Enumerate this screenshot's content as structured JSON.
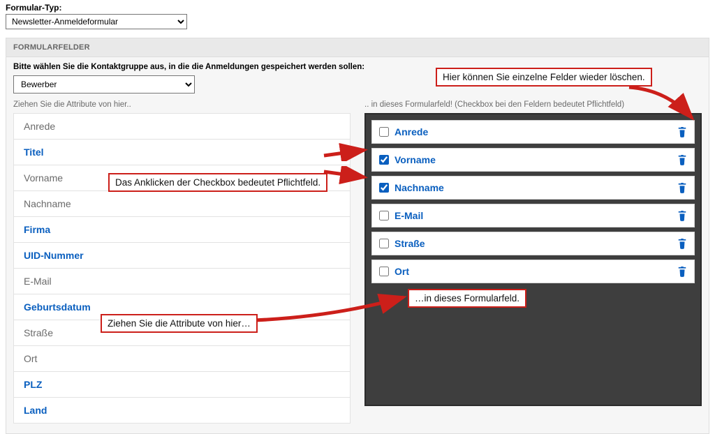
{
  "top": {
    "label": "Formular-Typ:",
    "typeSelected": "Newsletter-Anmeldeformular"
  },
  "panel": {
    "header": "FORMULARFELDER",
    "contactGroupLabel": "Bitte wählen Sie die Kontaktgruppe aus, in die die Anmeldungen gespeichert werden sollen:",
    "contactGroupSelected": "Bewerber",
    "leftHint": "Ziehen Sie die Attribute von hier..",
    "rightHint": ".. in dieses Formularfeld! (Checkbox bei den Feldern bedeutet Pflichtfeld)"
  },
  "attributes": [
    {
      "label": "Anrede",
      "style": "normal"
    },
    {
      "label": "Titel",
      "style": "blue"
    },
    {
      "label": "Vorname",
      "style": "normal"
    },
    {
      "label": "Nachname",
      "style": "normal"
    },
    {
      "label": "Firma",
      "style": "blue"
    },
    {
      "label": "UID-Nummer",
      "style": "blue"
    },
    {
      "label": "E-Mail",
      "style": "normal"
    },
    {
      "label": "Geburtsdatum",
      "style": "blue"
    },
    {
      "label": "Straße",
      "style": "normal"
    },
    {
      "label": "Ort",
      "style": "normal"
    },
    {
      "label": "PLZ",
      "style": "blue"
    },
    {
      "label": "Land",
      "style": "blue"
    }
  ],
  "fields": [
    {
      "label": "Anrede",
      "required": false
    },
    {
      "label": "Vorname",
      "required": true
    },
    {
      "label": "Nachname",
      "required": true
    },
    {
      "label": "E-Mail",
      "required": false
    },
    {
      "label": "Straße",
      "required": false
    },
    {
      "label": "Ort",
      "required": false
    }
  ],
  "annotations": {
    "delete": "Hier können Sie einzelne Felder wieder löschen.",
    "checkbox": "Das Anklicken der Checkbox bedeutet Pflichtfeld.",
    "dragFrom": "Ziehen Sie die Attribute von hier…",
    "dragTo": "…in dieses Formularfeld."
  },
  "colors": {
    "accent": "#0a5fbf",
    "annotation": "#cc1f1a"
  }
}
